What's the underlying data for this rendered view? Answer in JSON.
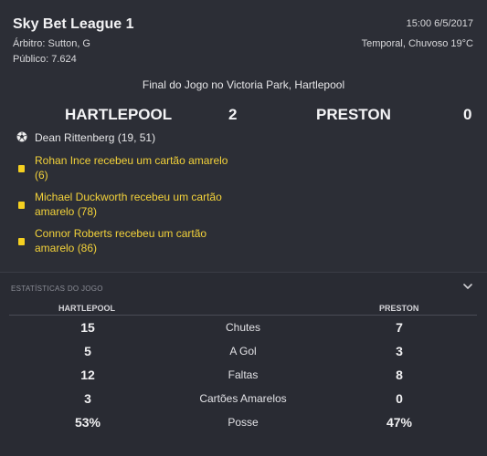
{
  "header": {
    "competition": "Sky Bet League 1",
    "referee": "Árbitro: Sutton, G",
    "attendance": "Público: 7.624",
    "datetime": "15:00 6/5/2017",
    "weather": "Temporal, Chuvoso 19°C"
  },
  "match": {
    "venue_line": "Final do Jogo no Victoria Park, Hartlepool",
    "home_team": "HARTLEPOOL",
    "home_score": "2",
    "away_team": "PRESTON",
    "away_score": "0"
  },
  "events": [
    {
      "type": "goal",
      "icon": "football-icon",
      "text": "Dean Rittenberg (19, 51)"
    },
    {
      "type": "yellow-card",
      "icon": "yellow-card-icon",
      "line1": "Rohan Ince recebeu um cartão amarelo",
      "line2": "(6)"
    },
    {
      "type": "yellow-card",
      "icon": "yellow-card-icon",
      "line1": "Michael Duckworth recebeu um cartão",
      "line2": "amarelo (78)"
    },
    {
      "type": "yellow-card",
      "icon": "yellow-card-icon",
      "line1": "Connor Roberts recebeu um cartão",
      "line2": "amarelo (86)"
    }
  ],
  "stats": {
    "section_title": "ESTATÍSTICAS DO JOGO",
    "home_header": "HARTLEPOOL",
    "away_header": "PRESTON",
    "rows": [
      {
        "home": "15",
        "label": "Chutes",
        "away": "7"
      },
      {
        "home": "5",
        "label": "A Gol",
        "away": "3"
      },
      {
        "home": "12",
        "label": "Faltas",
        "away": "8"
      },
      {
        "home": "3",
        "label": "Cartões Amarelos",
        "away": "0"
      },
      {
        "home": "53%",
        "label": "Posse",
        "away": "47%"
      }
    ]
  },
  "colors": {
    "background": "#2c2e36",
    "card_text": "#f3d23a",
    "card_icon": "#f5d020"
  }
}
